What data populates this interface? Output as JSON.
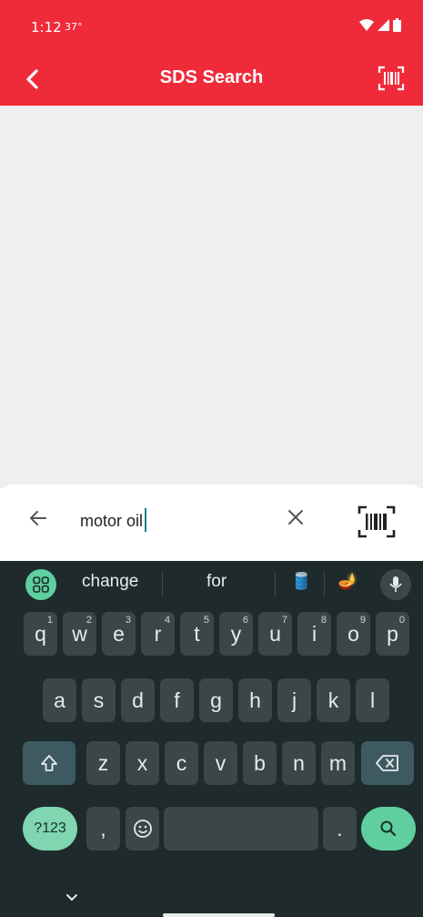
{
  "status_bar": {
    "time": "1:12",
    "temperature": "37°",
    "icons": [
      "wifi-icon",
      "signal-icon",
      "battery-icon"
    ]
  },
  "app_bar": {
    "title": "SDS Search",
    "back_icon": "chevron-left-icon",
    "scan_icon": "barcode-scan-icon",
    "background": "#ef2b3a"
  },
  "search": {
    "value": "motor oil",
    "back_icon": "arrow-left-icon",
    "clear_icon": "close-icon",
    "scan_icon": "barcode-scan-icon"
  },
  "keyboard": {
    "suggestions": [
      "change",
      "for"
    ],
    "emoji_suggestions": [
      "🛢️",
      "🪔"
    ],
    "row1": [
      {
        "key": "q",
        "hint": "1"
      },
      {
        "key": "w",
        "hint": "2"
      },
      {
        "key": "e",
        "hint": "3"
      },
      {
        "key": "r",
        "hint": "4"
      },
      {
        "key": "t",
        "hint": "5"
      },
      {
        "key": "y",
        "hint": "6"
      },
      {
        "key": "u",
        "hint": "7"
      },
      {
        "key": "i",
        "hint": "8"
      },
      {
        "key": "o",
        "hint": "9"
      },
      {
        "key": "p",
        "hint": "0"
      }
    ],
    "row2": [
      "a",
      "s",
      "d",
      "f",
      "g",
      "h",
      "j",
      "k",
      "l"
    ],
    "row3": [
      "z",
      "x",
      "c",
      "v",
      "b",
      "n",
      "m"
    ],
    "num_label": "?123",
    "comma_label": ",",
    "period_label": ".",
    "accent": "#5fcfa0"
  }
}
